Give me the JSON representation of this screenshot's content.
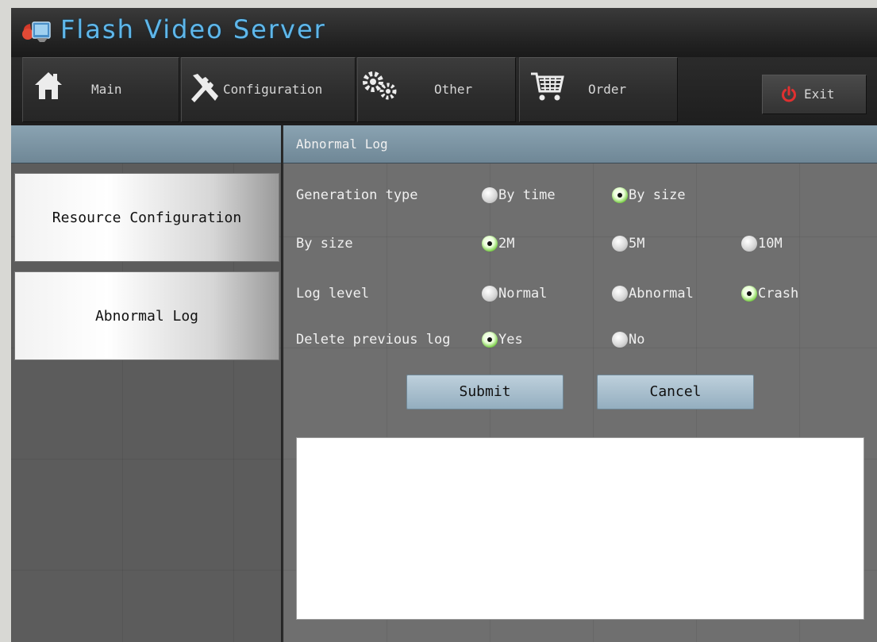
{
  "app": {
    "title": "Flash Video Server"
  },
  "nav": {
    "tabs": [
      {
        "label": "Main",
        "icon": "home-icon"
      },
      {
        "label": "Configuration",
        "icon": "tools-icon"
      },
      {
        "label": "Other",
        "icon": "gears-icon"
      },
      {
        "label": "Order",
        "icon": "cart-icon"
      }
    ],
    "exit": {
      "label": "Exit",
      "icon": "power-icon",
      "icon_color": "#e03030"
    }
  },
  "sidebar": {
    "items": [
      {
        "label": "Resource Configuration"
      },
      {
        "label": "Abnormal Log"
      }
    ]
  },
  "panel": {
    "title": "Abnormal Log",
    "rows": [
      {
        "label": "Generation type",
        "options": [
          {
            "label": "By time",
            "selected": false
          },
          {
            "label": "By size",
            "selected": true
          }
        ]
      },
      {
        "label": "By size",
        "options": [
          {
            "label": "2M",
            "selected": true
          },
          {
            "label": "5M",
            "selected": false
          },
          {
            "label": "10M",
            "selected": false
          }
        ]
      },
      {
        "label": "Log level",
        "options": [
          {
            "label": "Normal",
            "selected": false
          },
          {
            "label": "Abnormal",
            "selected": false
          },
          {
            "label": "Crash",
            "selected": true
          }
        ]
      },
      {
        "label": "Delete previous log",
        "options": [
          {
            "label": "Yes",
            "selected": true
          },
          {
            "label": "No",
            "selected": false
          }
        ]
      }
    ],
    "submit_label": "Submit",
    "cancel_label": "Cancel",
    "log_text": ""
  },
  "colors": {
    "title": "#5fb7ea",
    "header_bar": "#7f98a8",
    "radio_selected": "#6fc83a"
  }
}
